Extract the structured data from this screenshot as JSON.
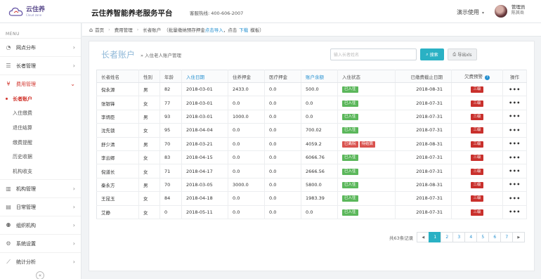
{
  "header": {
    "logo_main": "云住养",
    "logo_sub": "Cloud zone",
    "title": "云住养智能养老服务平台",
    "hotline": "客服热线: 400-606-2007",
    "demo_label": "演示使用",
    "user_role": "管理员",
    "user_name": "陈其岳"
  },
  "sidebar": {
    "caption": "MENU",
    "items": [
      {
        "label": "网点分布",
        "icon": "pie-icon"
      },
      {
        "label": "长者管理",
        "icon": "list-icon"
      },
      {
        "label": "费用管理",
        "icon": "yen-icon"
      },
      {
        "label": "机构管理",
        "icon": "building-icon"
      },
      {
        "label": "日常管理",
        "icon": "calendar-icon"
      },
      {
        "label": "组织机构",
        "icon": "org-icon"
      },
      {
        "label": "系统设置",
        "icon": "gear-icon"
      },
      {
        "label": "统计分析",
        "icon": "chart-icon"
      }
    ],
    "subitems": [
      "长者账户",
      "入住缴费",
      "退住结算",
      "缴费提醒",
      "历史收据",
      "机构收支"
    ]
  },
  "breadcrumb": {
    "home": "首页",
    "section": "费用管理",
    "page": "长者账户",
    "note_prefix": "（批量缴纳预存押金",
    "import_link": "点击导入",
    "note_mid": "，点击",
    "download_link": "下载",
    "note_suffix": "模板）"
  },
  "panel": {
    "title": "长者账户",
    "subtitle": "» 入住老人账户管理",
    "search_placeholder": "输入长者姓名",
    "search_label": "搜索",
    "export_label": "导出xls"
  },
  "table": {
    "headers": [
      "长者姓名",
      "性别",
      "年龄",
      "入住日期",
      "住养押金",
      "医疗押金",
      "账户余额",
      "入住状态",
      "已缴费截止日期",
      "欠费预警",
      "操作"
    ],
    "rows": [
      {
        "name": "倪永源",
        "gender": "男",
        "age": "82",
        "date": "2018-03-01",
        "deposit": "2433.0",
        "medical": "0.0",
        "balance": "500.0",
        "status": [
          "已入住"
        ],
        "paid_until": "2018-08-31",
        "warning": "三级",
        "action": "•••"
      },
      {
        "name": "张银锋",
        "gender": "女",
        "age": "77",
        "date": "2018-03-01",
        "deposit": "0.0",
        "medical": "0.0",
        "balance": "0.0",
        "status": [
          "已入住"
        ],
        "paid_until": "2018-07-31",
        "warning": "三级",
        "action": "•••"
      },
      {
        "name": "李炳臣",
        "gender": "男",
        "age": "93",
        "date": "2018-03-01",
        "deposit": "1000.0",
        "medical": "0.0",
        "balance": "0.0",
        "status": [
          "已入住"
        ],
        "paid_until": "2018-07-31",
        "warning": "三级",
        "action": "•••"
      },
      {
        "name": "沈先锁",
        "gender": "女",
        "age": "95",
        "date": "2018-04-04",
        "deposit": "0.0",
        "medical": "0.0",
        "balance": "700.02",
        "status": [
          "已入住"
        ],
        "paid_until": "2018-07-31",
        "warning": "三级",
        "action": "•••"
      },
      {
        "name": "舒少清",
        "gender": "男",
        "age": "70",
        "date": "2018-03-21",
        "deposit": "0.0",
        "medical": "0.0",
        "balance": "4059.2",
        "status": [
          "已离院",
          "待结算"
        ],
        "paid_until": "2018-08-31",
        "warning": "三级",
        "action": "•••"
      },
      {
        "name": "李云卿",
        "gender": "女",
        "age": "83",
        "date": "2018-04-15",
        "deposit": "0.0",
        "medical": "0.0",
        "balance": "6066.76",
        "status": [
          "已入住"
        ],
        "paid_until": "2018-07-31",
        "warning": "三级",
        "action": "•••"
      },
      {
        "name": "倪道长",
        "gender": "女",
        "age": "71",
        "date": "2018-04-17",
        "deposit": "0.0",
        "medical": "0.0",
        "balance": "2666.56",
        "status": [
          "已入住"
        ],
        "paid_until": "2018-07-31",
        "warning": "三级",
        "action": "•••"
      },
      {
        "name": "秦永方",
        "gender": "男",
        "age": "70",
        "date": "2018-03-05",
        "deposit": "3000.0",
        "medical": "0.0",
        "balance": "5800.0",
        "status": [
          "已入住"
        ],
        "paid_until": "2018-08-31",
        "warning": "三级",
        "action": "•••"
      },
      {
        "name": "王昆玉",
        "gender": "女",
        "age": "84",
        "date": "2018-04-18",
        "deposit": "0.0",
        "medical": "0.0",
        "balance": "1983.39",
        "status": [
          "已入住"
        ],
        "paid_until": "2018-07-31",
        "warning": "三级",
        "action": "•••"
      },
      {
        "name": "艾静",
        "gender": "女",
        "age": "0",
        "date": "2018-05-11",
        "deposit": "0.0",
        "medical": "0.0",
        "balance": "0.0",
        "status": [
          "已入住"
        ],
        "paid_until": "2018-07-31",
        "warning": "三级",
        "action": "•••"
      }
    ]
  },
  "pager": {
    "total": "共63条记录",
    "prev": "◀",
    "next": "▶",
    "pages": [
      "1",
      "2",
      "3",
      "4",
      "5",
      "6",
      "7"
    ],
    "current": "1"
  },
  "colors": {
    "accent": "#d1342c",
    "teal": "#2ab1c4",
    "link": "#2590d0",
    "status_green": "#5bb75b",
    "status_red": "#d9534f"
  }
}
